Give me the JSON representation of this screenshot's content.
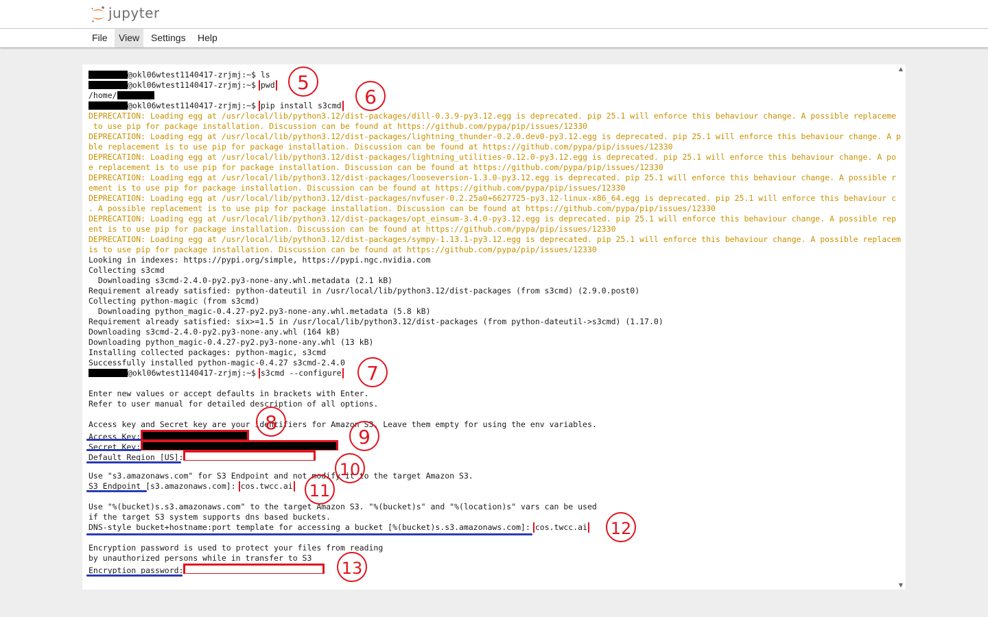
{
  "app": {
    "title": "jupyter"
  },
  "menu": {
    "items": [
      "File",
      "View",
      "Settings",
      "Help"
    ],
    "active": "View"
  },
  "terminal": {
    "prompt_suffix": "@okl06wtest1140417-zrjmj:~$ ",
    "home_prefix": "/home/",
    "commands": {
      "ls": "ls",
      "pwd": "pwd",
      "pip": "pip install s3cmd",
      "configure": "s3cmd --configure"
    },
    "deprecations": [
      "DEPRECATION: Loading egg at /usr/local/lib/python3.12/dist-packages/dill-0.3.9-py3.12.egg is deprecated. pip 25.1 will enforce this behaviour change. A possible replaceme",
      " to use pip for package installation. Discussion can be found at https://github.com/pypa/pip/issues/12330",
      "DEPRECATION: Loading egg at /usr/local/lib/python3.12/dist-packages/lightning_thunder-0.2.0.dev0-py3.12.egg is deprecated. pip 25.1 will enforce this behaviour change. A p",
      "ble replacement is to use pip for package installation. Discussion can be found at https://github.com/pypa/pip/issues/12330",
      "DEPRECATION: Loading egg at /usr/local/lib/python3.12/dist-packages/lightning_utilities-0.12.0-py3.12.egg is deprecated. pip 25.1 will enforce this behaviour change. A po",
      "e replacement is to use pip for package installation. Discussion can be found at https://github.com/pypa/pip/issues/12330",
      "DEPRECATION: Loading egg at /usr/local/lib/python3.12/dist-packages/looseversion-1.3.0-py3.12.egg is deprecated. pip 25.1 will enforce this behaviour change. A possible r",
      "ement is to use pip for package installation. Discussion can be found at https://github.com/pypa/pip/issues/12330",
      "DEPRECATION: Loading egg at /usr/local/lib/python3.12/dist-packages/nvfuser-0.2.25a0+6627725-py3.12-linux-x86_64.egg is deprecated. pip 25.1 will enforce this behaviour c",
      ". A possible replacement is to use pip for package installation. Discussion can be found at https://github.com/pypa/pip/issues/12330",
      "DEPRECATION: Loading egg at /usr/local/lib/python3.12/dist-packages/opt_einsum-3.4.0-py3.12.egg is deprecated. pip 25.1 will enforce this behaviour change. A possible rep",
      "ent is to use pip for package installation. Discussion can be found at https://github.com/pypa/pip/issues/12330",
      "DEPRECATION: Loading egg at /usr/local/lib/python3.12/dist-packages/sympy-1.13.1-py3.12.egg is deprecated. pip 25.1 will enforce this behaviour change. A possible replacem",
      "is to use pip for package installation. Discussion can be found at https://github.com/pypa/pip/issues/12330"
    ],
    "install_output": [
      "Looking in indexes: https://pypi.org/simple, https://pypi.ngc.nvidia.com",
      "Collecting s3cmd",
      "  Downloading s3cmd-2.4.0-py2.py3-none-any.whl.metadata (2.1 kB)",
      "Requirement already satisfied: python-dateutil in /usr/local/lib/python3.12/dist-packages (from s3cmd) (2.9.0.post0)",
      "Collecting python-magic (from s3cmd)",
      "  Downloading python_magic-0.4.27-py2.py3-none-any.whl.metadata (5.8 kB)",
      "Requirement already satisfied: six>=1.5 in /usr/local/lib/python3.12/dist-packages (from python-dateutil->s3cmd) (1.17.0)",
      "Downloading s3cmd-2.4.0-py2.py3-none-any.whl (164 kB)",
      "Downloading python_magic-0.4.27-py2.py3-none-any.whl (13 kB)",
      "Installing collected packages: python-magic, s3cmd",
      "Successfully installed python-magic-0.4.27 s3cmd-2.4.0"
    ],
    "configure": {
      "intro1": "Enter new values or accept defaults in brackets with Enter.",
      "intro2": "Refer to user manual for detailed description of all options.",
      "access_intro": "Access key and Secret key are your identifiers for Amazon S3. Leave them empty for using the env variables.",
      "access_key_label": "Access Key:",
      "secret_key_label": "Secret Key:",
      "region_label": "Default Region [US]:",
      "endpoint_intro": "Use \"s3.amazonaws.com\" for S3 Endpoint and not modify it to the target Amazon S3.",
      "endpoint_label": "S3 Endpoint [s3.amazonaws.com]:",
      "endpoint_value": "cos.twcc.ai",
      "dns_intro1": "Use \"%(bucket)s.s3.amazonaws.com\" to the target Amazon S3. \"%(bucket)s\" and \"%(location)s\" vars can be used",
      "dns_intro2": "if the target S3 system supports dns based buckets.",
      "dns_label": "DNS-style bucket+hostname:port template for accessing a bucket [%(bucket)s.s3.amazonaws.com]:",
      "dns_value": "cos.twcc.ai",
      "enc_intro1": "Encryption password is used to protect your files from reading",
      "enc_intro2": "by unauthorized persons while in transfer to S3",
      "enc_label": "Encryption password:"
    }
  },
  "annotations": {
    "numbers": [
      "5",
      "6",
      "7",
      "8",
      "9",
      "10",
      "11",
      "12",
      "13"
    ]
  },
  "colors": {
    "annotation_red": "#e0141e",
    "underline_blue": "#2b3bb6",
    "warning": "#c99000"
  }
}
